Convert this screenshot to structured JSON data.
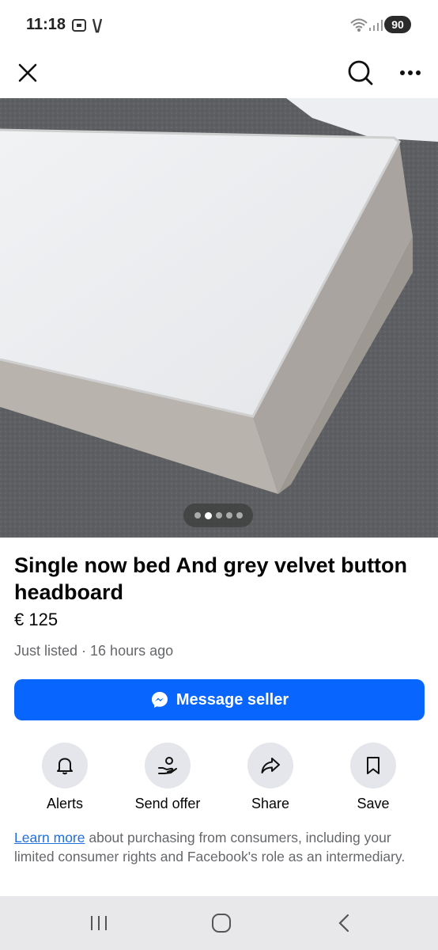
{
  "status_bar": {
    "time": "11:18",
    "battery": "90"
  },
  "nav": {
    "close_icon": "close-icon",
    "search_icon": "search-icon",
    "more_icon": "more-icon"
  },
  "photo": {
    "carousel_total": 5,
    "carousel_active_index": 1
  },
  "listing": {
    "title": "Single now bed And grey velvet button headboard",
    "price": "€ 125",
    "meta": "Just listed · 16 hours ago"
  },
  "primary_action": {
    "label": "Message seller",
    "color": "#0866ff"
  },
  "actions": [
    {
      "label": "Alerts",
      "icon": "bell-icon"
    },
    {
      "label": "Send offer",
      "icon": "send-offer-icon"
    },
    {
      "label": "Share",
      "icon": "share-icon"
    },
    {
      "label": "Save",
      "icon": "bookmark-icon"
    }
  ],
  "disclaimer": {
    "link_text": "Learn more",
    "text": " about purchasing from consumers, including your limited consumer rights and Facebook's role as an intermediary."
  }
}
